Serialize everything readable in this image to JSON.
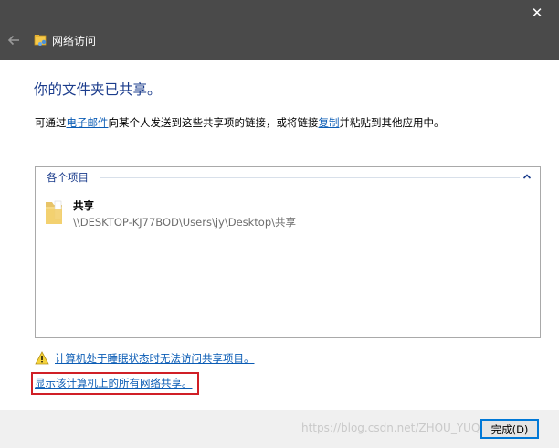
{
  "window": {
    "title": "网络访问",
    "close_glyph": "✕"
  },
  "main": {
    "heading": "你的文件夹已共享。",
    "description": {
      "part1": "可通过",
      "email_link": "电子邮件",
      "part2": "向某个人发送到这些共享项的链接，或将链接",
      "copy_link": "复制",
      "part3": "并粘贴到其他应用中。"
    }
  },
  "items_panel": {
    "header": "各个项目",
    "items": [
      {
        "name": "共享",
        "path": "\\\\DESKTOP-KJ77BOD\\Users\\jy\\Desktop\\共享"
      }
    ]
  },
  "links": {
    "sleep_warning": "计算机处于睡眠状态时无法访问共享项目。",
    "show_all_shares": "显示该计算机上的所有网络共享。"
  },
  "footer": {
    "done_label": "完成(D)",
    "watermark": "https://blog.csdn.net/ZHOU_YUQD"
  },
  "colors": {
    "titlebar": "#4a4a4a",
    "heading": "#1b3c8c",
    "link": "#0b5cb5",
    "highlight": "#d01f26",
    "accent": "#0078d7"
  }
}
